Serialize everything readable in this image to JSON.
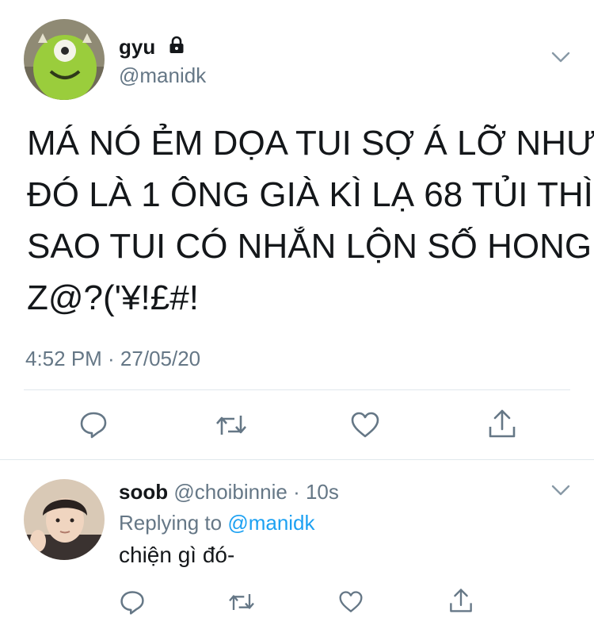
{
  "tweet": {
    "display_name": "gyu",
    "handle": "@manidk",
    "avatar_icon": "mike-wazowski-avatar",
    "protected_icon": "lock-icon",
    "text_lines": [
      "MÁ NÓ ẺM DỌA TUI SỢ Á LỠ NHƯ",
      "ĐÓ LÀ 1 ÔNG GIÀ KÌ LẠ 68 TỦI THÌ",
      "SAO TUI CÓ NHẮN LỘN SỐ HONG",
      "Z@?('¥!£#!"
    ],
    "timestamp": "4:52 PM · 27/05/20",
    "actions": [
      "reply-icon",
      "retweet-icon",
      "like-icon",
      "share-icon"
    ]
  },
  "reply": {
    "display_name": "soob",
    "handle": "@choibinnie",
    "time": "· 10s",
    "replying_to_label": "Replying to",
    "replying_to_handle": "@manidk",
    "text": "chiện gì đó-",
    "actions": [
      "reply-icon",
      "retweet-icon",
      "like-icon",
      "share-icon"
    ]
  },
  "colors": {
    "primary_text": "#14171a",
    "secondary_text": "#657786",
    "link": "#1da1f2",
    "divider": "#e1e8ed"
  }
}
